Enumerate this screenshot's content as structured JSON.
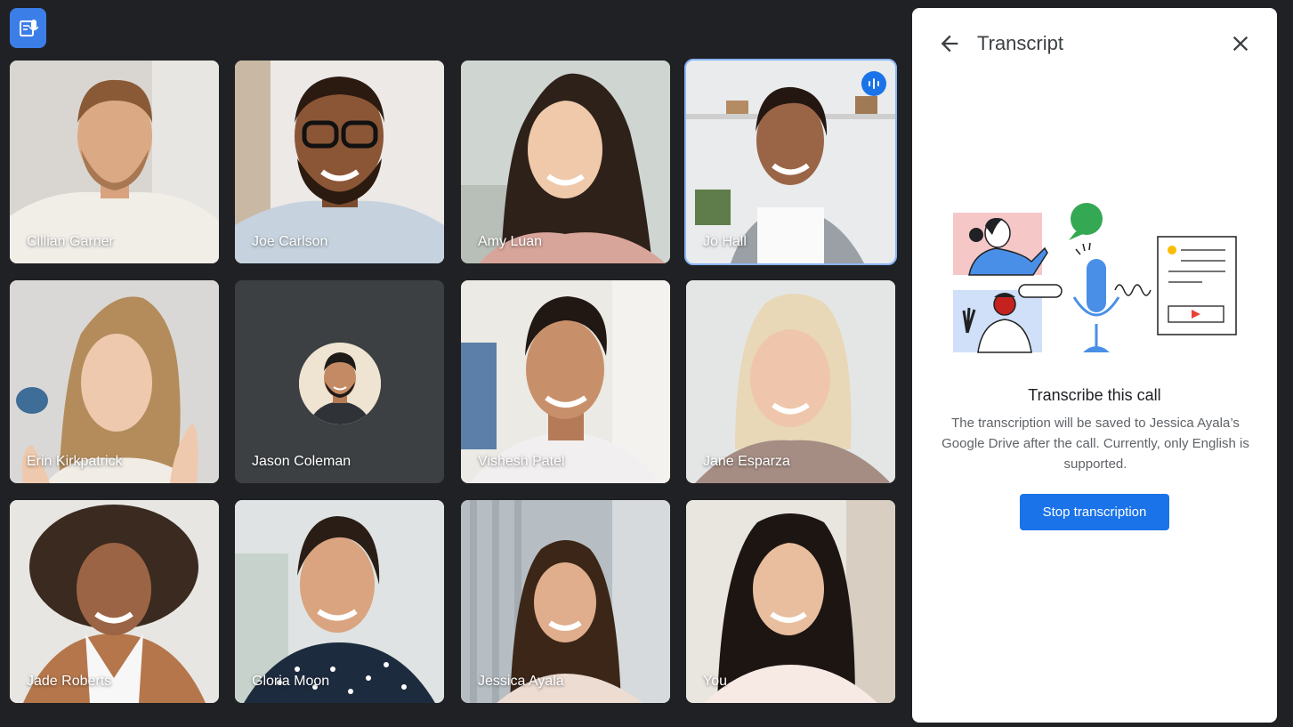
{
  "participants": [
    {
      "name": "Cillian Garner"
    },
    {
      "name": "Joe Carlson"
    },
    {
      "name": "Amy Luan"
    },
    {
      "name": "Jo Hall"
    },
    {
      "name": "Erin Kirkpatrick"
    },
    {
      "name": "Jason Coleman"
    },
    {
      "name": "Vishesh Patel"
    },
    {
      "name": "Jane Esparza"
    },
    {
      "name": "Jade Roberts"
    },
    {
      "name": "Gloria Moon"
    },
    {
      "name": "Jessica Ayala"
    },
    {
      "name": "You"
    }
  ],
  "panel": {
    "title": "Transcript",
    "heading": "Transcribe this call",
    "body": "The transcription will be saved to Jessica Ayala’s Google Drive after the call. Currently, only English is supported.",
    "button": "Stop transcription"
  },
  "icons": {
    "top": "transcript-icon",
    "back": "arrow-back-icon",
    "close": "close-icon",
    "speaking": "audio-level-icon"
  },
  "colors": {
    "accent": "#1a73e8",
    "active_border": "#8ab4f8",
    "background": "#202124"
  }
}
